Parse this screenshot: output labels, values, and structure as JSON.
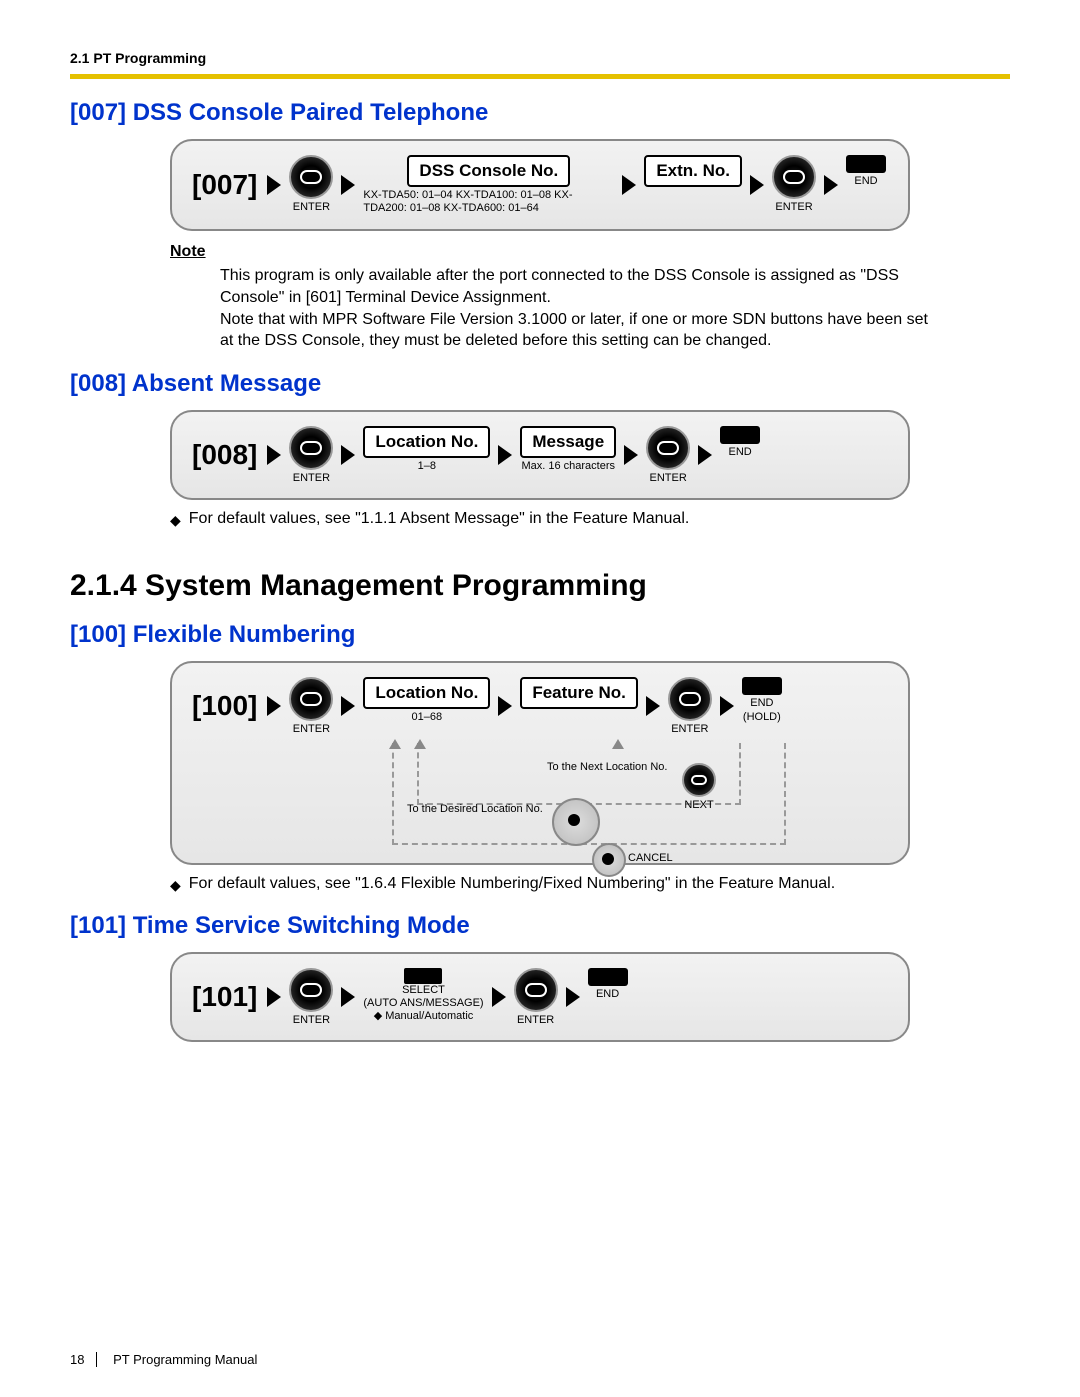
{
  "header": {
    "crumb": "2.1 PT Programming"
  },
  "sec007": {
    "title": "[007] DSS Console Paired Telephone",
    "code": "[007]",
    "enter": "ENTER",
    "box1": "DSS Console No.",
    "box1_sub": "KX-TDA50: 01–04\nKX-TDA100: 01–08\nKX-TDA200: 01–08\nKX-TDA600: 01–64",
    "box2": "Extn. No.",
    "end": "END",
    "note_h": "Note",
    "note_body": "This program is only available after the port connected to the DSS Console is assigned as \"DSS Console\" in [601] Terminal Device Assignment.\nNote that with MPR Software File Version 3.1000 or later, if one or more SDN buttons have been set at the DSS Console, they must be deleted before this setting can be changed."
  },
  "sec008": {
    "title": "[008] Absent Message",
    "code": "[008]",
    "enter": "ENTER",
    "box1": "Location No.",
    "box1_sub": "1–8",
    "box2": "Message",
    "box2_sub": "Max. 16 characters",
    "end": "END",
    "bullet": "For default values, see \"1.1.1 Absent Message\" in the Feature Manual."
  },
  "sec214": {
    "title": "2.1.4   System Management Programming"
  },
  "sec100": {
    "title": "[100] Flexible Numbering",
    "code": "[100]",
    "enter": "ENTER",
    "box1": "Location No.",
    "box1_sub": "01–68",
    "box2": "Feature No.",
    "end": "END",
    "hold": "(HOLD)",
    "anno_next": "To the Next Location No.",
    "anno_desired": "To the Desired Location No.",
    "next": "NEXT",
    "cancel": "CANCEL",
    "bullet": "For default values, see \"1.6.4 Flexible Numbering/Fixed Numbering\" in the Feature Manual."
  },
  "sec101": {
    "title": "[101] Time Service Switching Mode",
    "code": "[101]",
    "enter": "ENTER",
    "select": "SELECT",
    "select_sub1": "(AUTO ANS/MESSAGE)",
    "select_sub2": "◆ Manual/Automatic",
    "end": "END"
  },
  "footer": {
    "page": "18",
    "title": "PT Programming Manual"
  }
}
